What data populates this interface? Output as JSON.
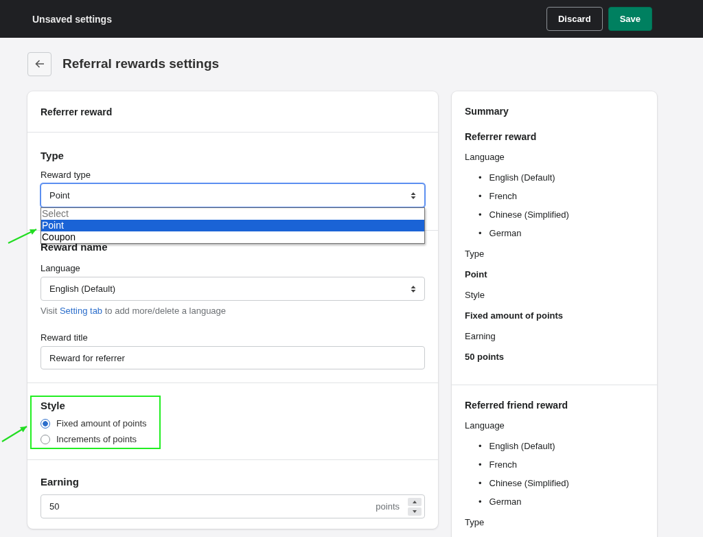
{
  "top_bar": {
    "title": "Unsaved settings",
    "buttons": [
      {
        "label": "Discard",
        "kind": "secondary"
      },
      {
        "label": "Save",
        "kind": "primary"
      }
    ]
  },
  "page": {
    "title": "Referral rewards settings"
  },
  "main_card": {
    "title": "Referrer reward",
    "type_section": {
      "title": "Type",
      "field_label": "Reward type",
      "value": "Point",
      "expanded": true,
      "options": [
        {
          "label": "Select",
          "kind": "placeholder",
          "selected": false
        },
        {
          "label": "Point",
          "kind": "option",
          "selected": true
        },
        {
          "label": "Coupon",
          "kind": "option",
          "selected": false
        }
      ]
    },
    "name_section": {
      "title": "Reward name",
      "language_label": "Language",
      "language_value": "English (Default)",
      "help": {
        "before": "Visit ",
        "link": "Setting tab",
        "after": " to add more/delete a language"
      },
      "title_label": "Reward title",
      "title_value": "Reward for referrer"
    },
    "style_section": {
      "title": "Style",
      "options": [
        {
          "label": "Fixed amount of points",
          "selected": true
        },
        {
          "label": "Increments of points",
          "selected": false
        }
      ]
    },
    "earning_section": {
      "title": "Earning",
      "value": "50",
      "suffix": "points"
    }
  },
  "summary": {
    "title": "Summary",
    "groups": [
      {
        "title": "Referrer reward",
        "items": [
          {
            "kind": "label",
            "text": "Language"
          },
          {
            "kind": "list",
            "marker": "•",
            "entries": [
              "English (Default)",
              "French",
              "Chinese (Simplified)",
              "German"
            ]
          },
          {
            "kind": "label",
            "text": "Type"
          },
          {
            "kind": "value",
            "text": "Point"
          },
          {
            "kind": "label",
            "text": "Style"
          },
          {
            "kind": "value",
            "text": "Fixed amount of points"
          },
          {
            "kind": "label",
            "text": "Earning"
          },
          {
            "kind": "value",
            "text": "50 points"
          }
        ]
      },
      {
        "title": "Referred friend reward",
        "items": [
          {
            "kind": "label",
            "text": "Language"
          },
          {
            "kind": "list",
            "marker": "•",
            "entries": [
              "English (Default)",
              "French",
              "Chinese (Simplified)",
              "German"
            ]
          },
          {
            "kind": "label",
            "text": "Type"
          }
        ]
      }
    ]
  }
}
